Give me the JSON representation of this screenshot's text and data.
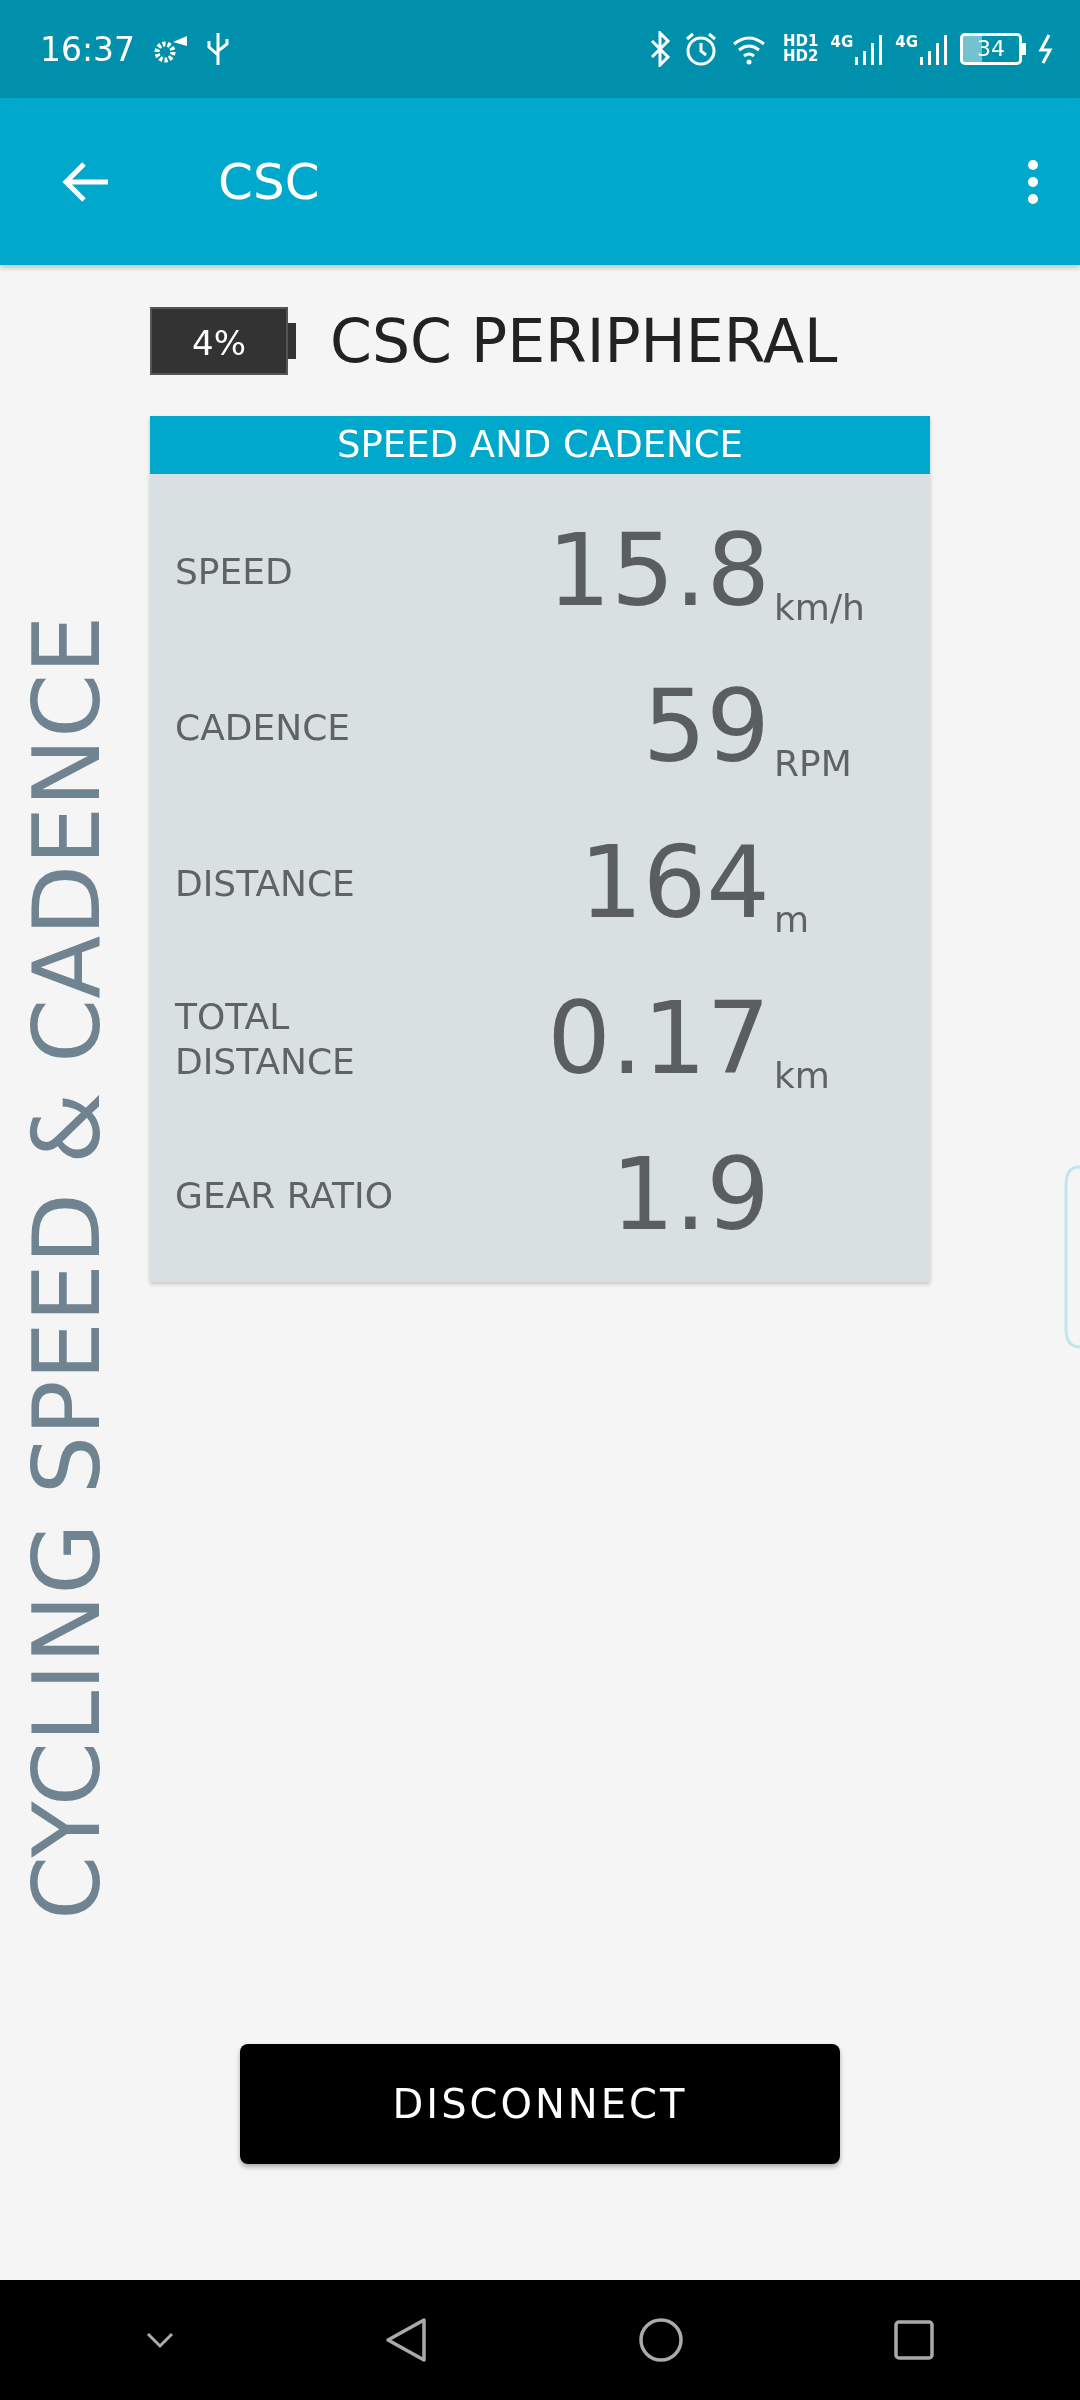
{
  "status_bar": {
    "time": "16:37",
    "hd": [
      "HD1",
      "HD2"
    ],
    "network": [
      "4G",
      "4G"
    ],
    "battery": "34"
  },
  "app_bar": {
    "title": "CSC"
  },
  "device": {
    "battery": "4%",
    "name": "CSC PERIPHERAL"
  },
  "card": {
    "title": "SPEED AND CADENCE",
    "rows": [
      {
        "label": "SPEED",
        "value": "15.8",
        "unit": "km/h"
      },
      {
        "label": "CADENCE",
        "value": "59",
        "unit": "RPM"
      },
      {
        "label": "DISTANCE",
        "value": "164",
        "unit": "m"
      },
      {
        "label": "TOTAL DISTANCE",
        "value": "0.17",
        "unit": "km"
      },
      {
        "label": "GEAR RATIO",
        "value": "1.9"
      }
    ]
  },
  "side_title": "CYCLING SPEED & CADENCE",
  "button": "DISCONNECT"
}
